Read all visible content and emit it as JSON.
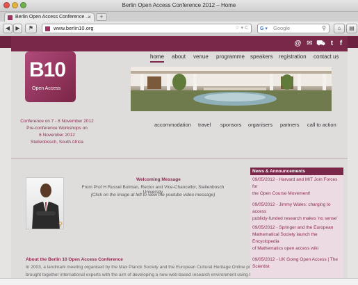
{
  "window": {
    "title": "Berlin Open Access Conference 2012 – Home"
  },
  "tabs": [
    {
      "label": "Berlin Open Access Conference ..."
    }
  ],
  "toolbar": {
    "url": "www.berlin10.org",
    "search_placeholder": "Google"
  },
  "site": {
    "logo": {
      "big": "B10",
      "small": "Open Access"
    },
    "nav": [
      "home",
      "about",
      "venue",
      "programme",
      "speakers",
      "registration",
      "contact us"
    ],
    "subnav": [
      "accommodation",
      "travel",
      "sponsors",
      "organisers",
      "partners",
      "call to action"
    ],
    "conference_info": [
      "Conference on 7 - 8 November 2012",
      "Pre-conference Workshops on",
      "6 November 2012",
      "Stellenbosch, South Africa"
    ],
    "welcome": {
      "title": "Welcoming Message",
      "from": "From Prof H Russel Botman, Rector and Vice-Chancellor, Stellenbosch University",
      "click": "(Click on the image at left to view the youtube video message)"
    },
    "about": {
      "title": "About the Berlin 10 Open Access Conference",
      "lines": [
        "In 2003, a landmark meeting organised by the Max Planck Society and the European Cultural Heritage Online project",
        "brought together international experts with the aim of developing a new web-based research environment using the"
      ]
    },
    "news": {
      "title": "News & Announcements",
      "items": [
        [
          "09/05/2012 - Harvard and MIT Join Forces for",
          "the Open Course Movement!"
        ],
        [
          "09/05/2012 - Jimmy Wales: charging to access",
          "publicly-funded research makes 'no sense'"
        ],
        [
          "09/05/2012 - Springer and the European",
          "Mathematical Society launch the Encyclopedia",
          "of Mathematics open access wiki"
        ],
        [
          "09/05/2012 - UK Going Open Access | The",
          "Scientist"
        ]
      ]
    },
    "colors": {
      "brand": "#7a2849",
      "accent_text": "#8a2e50"
    }
  }
}
